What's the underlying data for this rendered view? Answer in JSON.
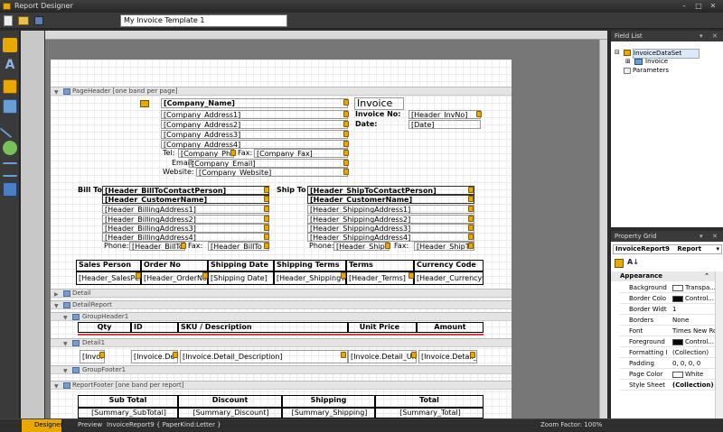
{
  "app": {
    "title": "Report Designer",
    "report_name": "My Invoice Template 1"
  },
  "colors": {
    "chrome": "#3a3a3a",
    "accent": "#e8a800",
    "selected": "#dde8f8"
  },
  "bands": {
    "page_header": "PageHeader [one band per page]",
    "detail": "Detail",
    "detail_report": "DetailReport",
    "group_header": "GroupHeader1",
    "detail1": "Detail1",
    "group_footer": "GroupFooter1",
    "report_footer": "ReportFooter [one band per report]"
  },
  "company": {
    "name": "[Company_Name]",
    "addr1": "[Company_Address1]",
    "addr2": "[Company_Address2]",
    "addr3": "[Company_Address3]",
    "addr4": "[Company_Address4]",
    "tel_label": "Tel:",
    "tel": "[Company_Phon",
    "fax_label": "Fax:",
    "fax": "[Company_Fax]",
    "email_label": "Email:",
    "email": "[Company_Email]",
    "website_label": "Website:",
    "website": "[Company_Website]"
  },
  "invoice": {
    "title": "Invoice",
    "no_label": "Invoice No:",
    "no": "[Header_InvNo]",
    "date_label": "Date:",
    "date": "[Date]"
  },
  "bill_to": {
    "label": "Bill To",
    "contact": "[Header_BillToContactPerson]",
    "customer": "[Header_CustomerName]",
    "addr1": "[Header_BillingAddress1]",
    "addr2": "[Header_BillingAddress2]",
    "addr3": "[Header_BillingAddress3]",
    "addr4": "[Header_BillingAddress4]",
    "phone_label": "Phone:",
    "phone": "[Header_BillTo",
    "fax_label": "Fax:",
    "fax": "[Header_BillTo"
  },
  "ship_to": {
    "label": "Ship To",
    "contact": "[Header_ShipToContactPerson]",
    "customer": "[Header_CustomerName]",
    "addr1": "[Header_ShippingAddress1]",
    "addr2": "[Header_ShippingAddress2]",
    "addr3": "[Header_ShippingAddress3]",
    "addr4": "[Header_ShippingAddress4]",
    "phone_label": "Phone:",
    "phone": "[Header_ShipTo",
    "fax_label": "Fax:",
    "fax": "[Header_ShipTo"
  },
  "order_table": {
    "headers": [
      "Sales Person",
      "Order No",
      "Shipping Date",
      "Shipping Terms",
      "Terms",
      "Currency Code"
    ],
    "cells": [
      "[Header_SalesPers",
      "[Header_OrderNo]",
      "[Shipping Date]",
      "[Header_ShippingTe",
      "[Header_Terms]",
      "[Header_CurrencyC"
    ]
  },
  "item_table": {
    "headers": [
      "Qty",
      "ID",
      "SKU / Description",
      "Unit Price",
      "Amount"
    ],
    "cells": [
      "[Invoi",
      "[Invoice.De",
      "[Invoice.Detail_Description]",
      "[Invoice.Detail_Uni",
      "[Invoice.Detail_A"
    ]
  },
  "totals": {
    "headers": [
      "Sub Total",
      "Discount",
      "Shipping",
      "Total"
    ],
    "cells": [
      "[Summary_SubTotal]",
      "[Summary_Discount]",
      "[Summary_Shipping]",
      "[Summary_Total]"
    ]
  },
  "field_list": {
    "title": "Field List",
    "items": [
      "InvoiceDataSet",
      "Invoice",
      "Parameters"
    ]
  },
  "property_grid": {
    "title": "Property Grid",
    "selector": "InvoiceReport9",
    "selector_type": "Report",
    "section": "Appearance",
    "rows": [
      {
        "name": "Background",
        "value": "Transpa..."
      },
      {
        "name": "Border Colo",
        "value": "Control..."
      },
      {
        "name": "Border Widt",
        "value": "1"
      },
      {
        "name": "Borders",
        "value": "None"
      },
      {
        "name": "Font",
        "value": "Times New Ro..."
      },
      {
        "name": "Foreground",
        "value": "Control..."
      },
      {
        "name": "Formatting I",
        "value": "(Collection)"
      },
      {
        "name": "Padding",
        "value": "0, 0, 0, 0"
      },
      {
        "name": "Page Color",
        "value": "White"
      },
      {
        "name": "Style Sheet",
        "value": "(Collection)"
      }
    ]
  },
  "status": {
    "designer_tab": "Designer",
    "preview_tab": "Preview",
    "doc": "InvoiceReport9 { PaperKind:Letter }",
    "zoom": "Zoom Factor: 100%"
  }
}
